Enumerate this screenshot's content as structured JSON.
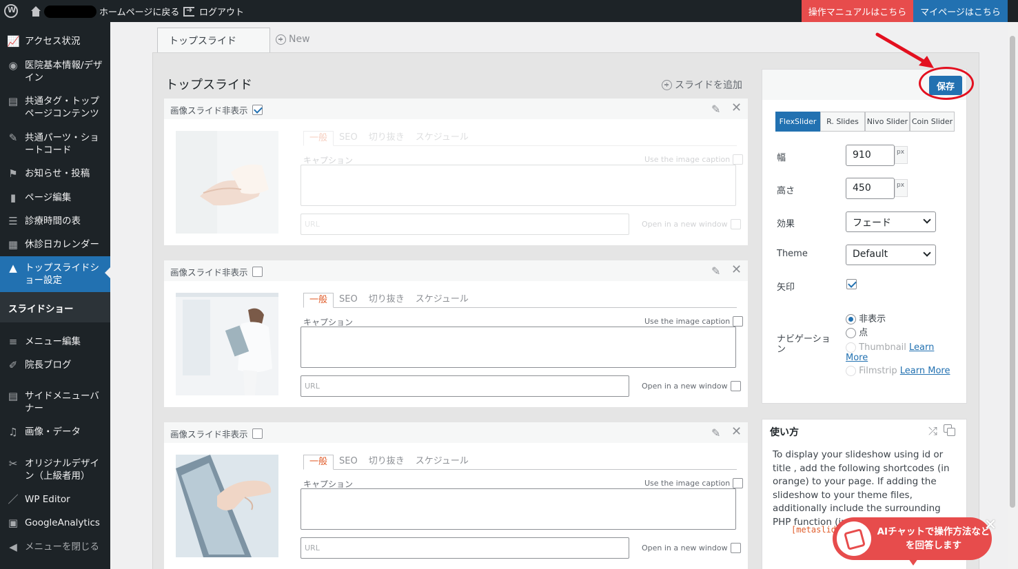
{
  "adminbar": {
    "home_label": "ホームページに戻る",
    "logout_label": "ログアウト",
    "manual_label": "操作マニュアルはこちら",
    "mypage_label": "マイページはこちら"
  },
  "sidebar": {
    "items": [
      {
        "label": "アクセス状況",
        "icon": "chart-icon"
      },
      {
        "label": "医院基本情報/デザイン",
        "icon": "eye-icon"
      },
      {
        "label": "共通タグ・トップページコンテンツ",
        "icon": "layout-icon"
      },
      {
        "label": "共通パーツ・ショートコード",
        "icon": "pin-icon"
      },
      {
        "label": "お知らせ・投稿",
        "icon": "flag-icon"
      },
      {
        "label": "ページ編集",
        "icon": "page-icon"
      },
      {
        "label": "診療時間の表",
        "icon": "table-icon"
      },
      {
        "label": "休診日カレンダー",
        "icon": "calendar-icon"
      },
      {
        "label": "トップスライドショー設定",
        "icon": "mountain-icon"
      },
      {
        "label": "メニュー編集",
        "icon": "menu-icon"
      },
      {
        "label": "院長ブログ",
        "icon": "edit-icon"
      },
      {
        "label": "サイドメニューバナー",
        "icon": "form-icon"
      },
      {
        "label": "画像・データ",
        "icon": "media-icon"
      },
      {
        "label": "オリジナルデザイン（上級者用）",
        "icon": "tools-icon"
      },
      {
        "label": "WP Editor",
        "icon": "brush-icon"
      },
      {
        "label": "GoogleAnalytics",
        "icon": "ga-icon"
      },
      {
        "label": "メニューを閉じる",
        "icon": "collapse-icon"
      }
    ],
    "submenu_label": "スライドショー"
  },
  "tabs": {
    "slide_tab": "トップスライド",
    "new_tab": "New"
  },
  "editor": {
    "title": "トップスライド",
    "add_slide": "スライドを追加",
    "slides": [
      {
        "hide_label": "画像スライド非表示",
        "hidden": true
      },
      {
        "hide_label": "画像スライド非表示",
        "hidden": false
      },
      {
        "hide_label": "画像スライド非表示",
        "hidden": false
      }
    ],
    "subtabs": [
      "一般",
      "SEO",
      "切り抜き",
      "スケジュール"
    ],
    "caption_label": "キャプション",
    "use_caption_label": "Use the image caption",
    "url_placeholder": "URL",
    "new_window_label": "Open in a new window"
  },
  "settings": {
    "save_label": "保存",
    "slider_types": [
      "FlexSlider",
      "R. Slides",
      "Nivo Slider",
      "Coin Slider"
    ],
    "active_slider": "FlexSlider",
    "width_label": "幅",
    "width_value": "910",
    "height_label": "高さ",
    "height_value": "450",
    "unit": "px",
    "effect_label": "効果",
    "effect_value": "フェード",
    "theme_label": "Theme",
    "theme_value": "Default",
    "arrows_label": "矢印",
    "arrows_checked": true,
    "navigation_label": "ナビゲーション",
    "nav_options": {
      "hidden": "非表示",
      "dots": "点",
      "thumbnail": "Thumbnail",
      "filmstrip": "Filmstrip",
      "learn_more": "Learn More"
    },
    "nav_selected": "非表示"
  },
  "usage": {
    "title": "使い方",
    "text": "To display your slideshow using id or title , add the following shortcodes (in orange) to your page. If adding the slideshow to your theme files, additionally include the surrounding PHP function (in gray).",
    "code": "[metaslide"
  },
  "ai_chat": {
    "text": "AIチャットで操作方法などを回答します"
  },
  "colors": {
    "admin_bg": "#1d2327",
    "accent_blue": "#2271b1",
    "manual_red": "#e74c4c",
    "tab_orange": "#e05d2b"
  }
}
